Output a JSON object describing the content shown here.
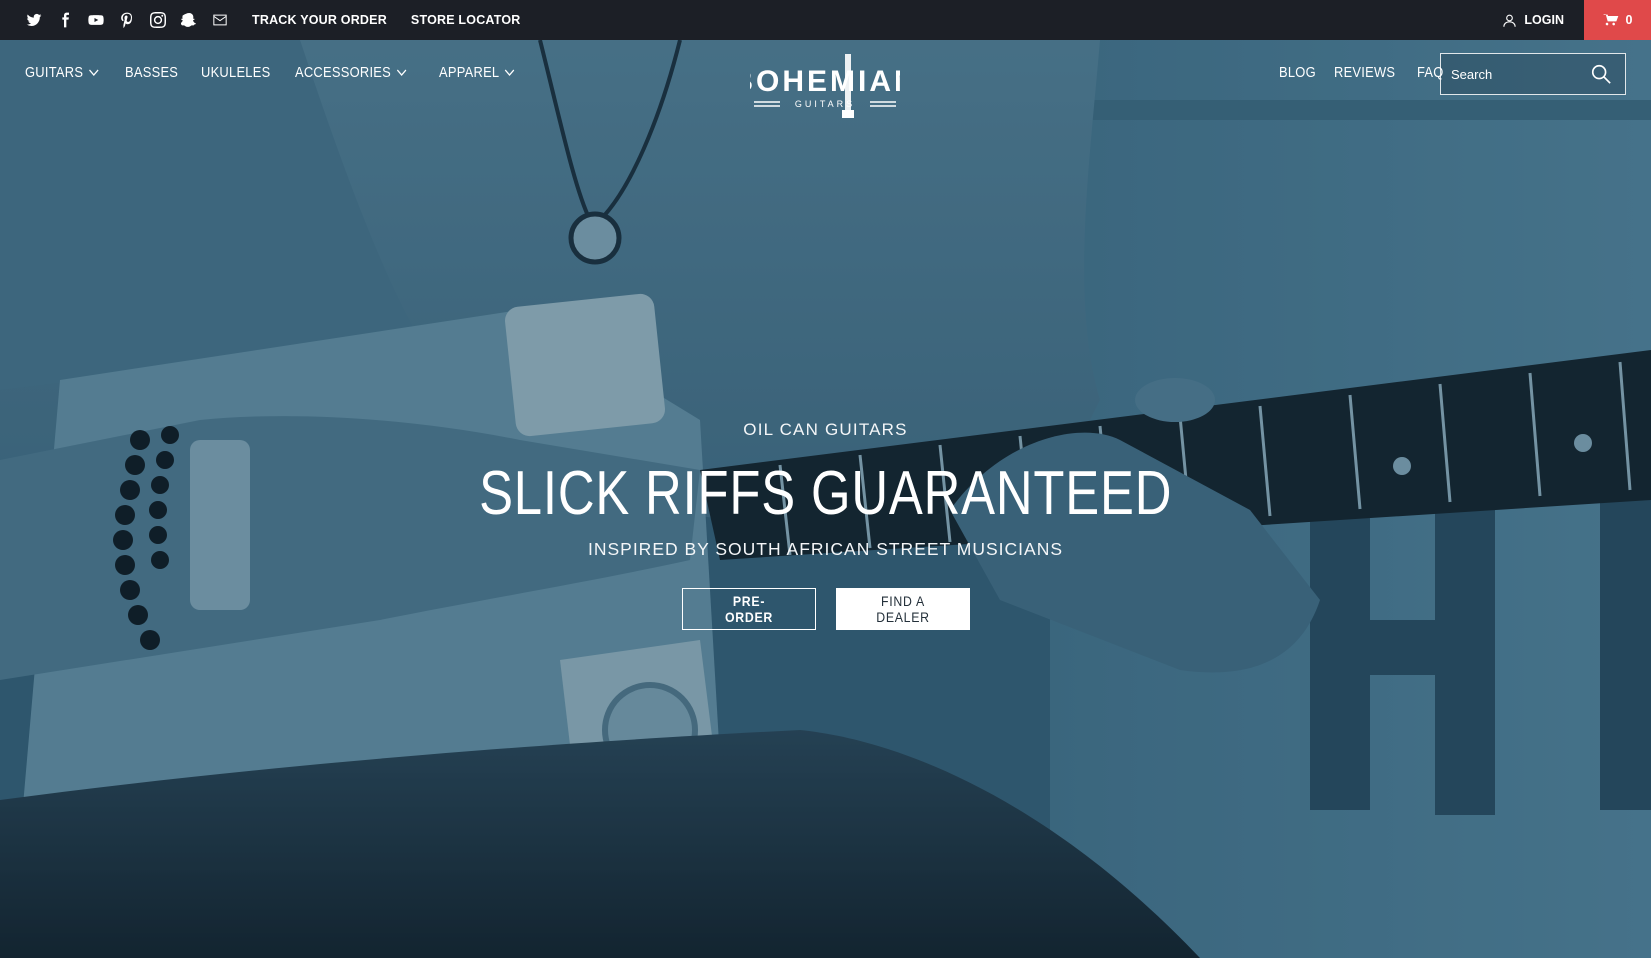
{
  "topbar": {
    "social_icons": [
      "twitter-icon",
      "facebook-icon",
      "youtube-icon",
      "pinterest-icon",
      "instagram-icon",
      "snapchat-icon",
      "mail-icon"
    ],
    "links": [
      "TRACK YOUR ORDER",
      "STORE LOCATOR"
    ],
    "login_label": "LOGIN",
    "cart_count": "0",
    "cart_color": "#e0494a"
  },
  "nav": {
    "left_items": [
      {
        "label": "GUITARS",
        "has_dropdown": true
      },
      {
        "label": "BASSES",
        "has_dropdown": false
      },
      {
        "label": "UKULELES",
        "has_dropdown": false
      },
      {
        "label": "ACCESSORIES",
        "has_dropdown": true
      },
      {
        "label": "APPAREL",
        "has_dropdown": true
      }
    ],
    "right_items": [
      {
        "label": "BLOG"
      },
      {
        "label": "REVIEWS"
      },
      {
        "label": "FAQ"
      }
    ],
    "search_placeholder": "Search"
  },
  "logo": {
    "wordmark": "BOHEMIAN",
    "tagline": "GUITARS"
  },
  "hero": {
    "eyebrow": "OIL CAN GUITARS",
    "headline": "SLICK RIFFS GUARANTEED",
    "subline": "INSPIRED BY SOUTH AFRICAN STREET MUSICIANS",
    "primary_cta": "PRE-ORDER",
    "secondary_cta": "FIND A DEALER",
    "tint_color": "#3a6680"
  }
}
